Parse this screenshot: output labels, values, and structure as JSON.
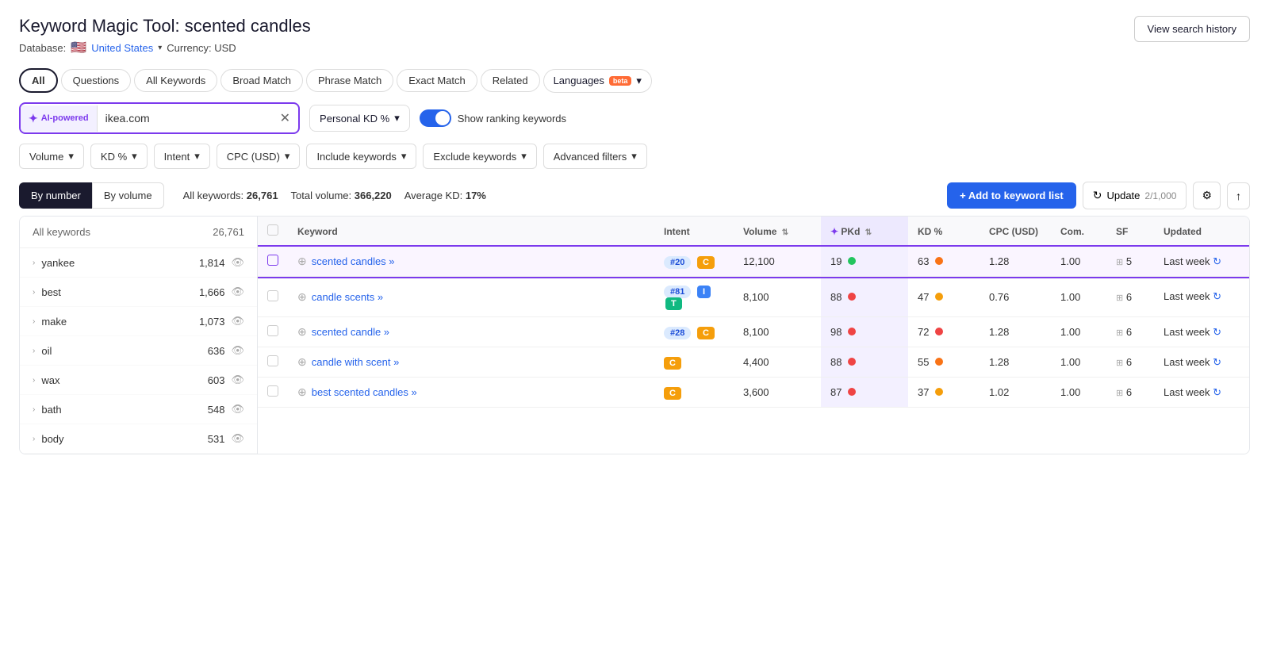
{
  "header": {
    "tool_name": "Keyword Magic Tool:",
    "search_term": "scented candles",
    "view_history_label": "View search history",
    "database_label": "Database:",
    "database_country": "United States",
    "currency_label": "Currency: USD"
  },
  "tabs": [
    {
      "id": "all",
      "label": "All",
      "active": true
    },
    {
      "id": "questions",
      "label": "Questions",
      "active": false
    },
    {
      "id": "all-keywords",
      "label": "All Keywords",
      "active": false
    },
    {
      "id": "broad-match",
      "label": "Broad Match",
      "active": false
    },
    {
      "id": "phrase-match",
      "label": "Phrase Match",
      "active": false
    },
    {
      "id": "exact-match",
      "label": "Exact Match",
      "active": false
    },
    {
      "id": "related",
      "label": "Related",
      "active": false
    },
    {
      "id": "languages",
      "label": "Languages",
      "active": false,
      "beta": true
    }
  ],
  "search": {
    "ai_powered_label": "AI-powered",
    "input_value": "ikea.com",
    "kd_label": "Personal KD %",
    "toggle_label": "Show ranking keywords"
  },
  "filters": [
    {
      "id": "volume",
      "label": "Volume"
    },
    {
      "id": "kd",
      "label": "KD %"
    },
    {
      "id": "intent",
      "label": "Intent"
    },
    {
      "id": "cpc",
      "label": "CPC (USD)"
    },
    {
      "id": "include-keywords",
      "label": "Include keywords"
    },
    {
      "id": "exclude-keywords",
      "label": "Exclude keywords"
    },
    {
      "id": "advanced-filters",
      "label": "Advanced filters"
    }
  ],
  "results": {
    "sort_by_number_label": "By number",
    "sort_by_volume_label": "By volume",
    "all_keywords_label": "All keywords:",
    "all_keywords_count": "26,761",
    "total_volume_label": "Total volume:",
    "total_volume_value": "366,220",
    "average_kd_label": "Average KD:",
    "average_kd_value": "17%",
    "add_keyword_label": "+ Add to keyword list",
    "update_label": "Update",
    "update_count": "2/1,000"
  },
  "table": {
    "columns": [
      {
        "id": "keyword",
        "label": "Keyword"
      },
      {
        "id": "intent",
        "label": "Intent"
      },
      {
        "id": "volume",
        "label": "Volume"
      },
      {
        "id": "pkd",
        "label": "✦ PKd"
      },
      {
        "id": "kd",
        "label": "KD %"
      },
      {
        "id": "cpc",
        "label": "CPC (USD)"
      },
      {
        "id": "com",
        "label": "Com."
      },
      {
        "id": "sf",
        "label": "SF"
      },
      {
        "id": "updated",
        "label": "Updated"
      }
    ],
    "rows": [
      {
        "selected": true,
        "keyword": "scented candles",
        "keyword_suffix": "»",
        "rank": "#20",
        "intent": [
          "C"
        ],
        "volume": "12,100",
        "pkd": "19",
        "pkd_dot": "green",
        "kd": "63",
        "kd_dot": "orange",
        "cpc": "1.28",
        "com": "1.00",
        "sf": "5",
        "updated": "Last week"
      },
      {
        "selected": false,
        "keyword": "candle scents",
        "keyword_suffix": "»",
        "rank": "#81",
        "intent": [
          "I",
          "T"
        ],
        "volume": "8,100",
        "pkd": "88",
        "pkd_dot": "red",
        "kd": "47",
        "kd_dot": "yellow",
        "cpc": "0.76",
        "com": "1.00",
        "sf": "6",
        "updated": "Last week"
      },
      {
        "selected": false,
        "keyword": "scented candle",
        "keyword_suffix": "»",
        "rank": "#28",
        "intent": [
          "C"
        ],
        "volume": "8,100",
        "pkd": "98",
        "pkd_dot": "red",
        "kd": "72",
        "kd_dot": "red",
        "cpc": "1.28",
        "com": "1.00",
        "sf": "6",
        "updated": "Last week"
      },
      {
        "selected": false,
        "keyword": "candle with scent",
        "keyword_suffix": "»",
        "rank": null,
        "intent": [
          "C"
        ],
        "volume": "4,400",
        "pkd": "88",
        "pkd_dot": "red",
        "kd": "55",
        "kd_dot": "orange",
        "cpc": "1.28",
        "com": "1.00",
        "sf": "6",
        "updated": "Last week"
      },
      {
        "selected": false,
        "keyword": "best scented candles",
        "keyword_suffix": "»",
        "rank": null,
        "intent": [
          "C"
        ],
        "volume": "3,600",
        "pkd": "87",
        "pkd_dot": "red",
        "kd": "37",
        "kd_dot": "yellow",
        "cpc": "1.02",
        "com": "1.00",
        "sf": "6",
        "updated": "Last week"
      }
    ]
  },
  "sidebar": {
    "header_label": "All keywords",
    "header_count": "26,761",
    "items": [
      {
        "keyword": "yankee",
        "count": "1,814"
      },
      {
        "keyword": "best",
        "count": "1,666"
      },
      {
        "keyword": "make",
        "count": "1,073"
      },
      {
        "keyword": "oil",
        "count": "636"
      },
      {
        "keyword": "wax",
        "count": "603"
      },
      {
        "keyword": "bath",
        "count": "548"
      },
      {
        "keyword": "body",
        "count": "531"
      }
    ]
  }
}
